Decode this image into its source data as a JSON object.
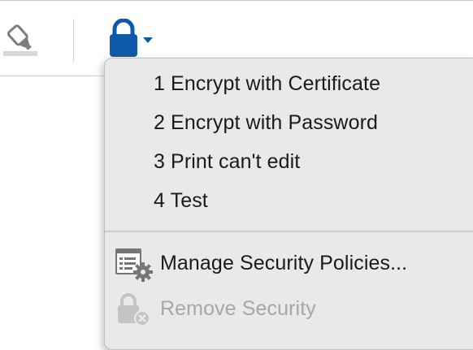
{
  "toolbar": {
    "highlighter_icon": "highlighter-pen-icon",
    "security_icon": "lock-icon",
    "security_caret_icon": "chevron-down-icon",
    "accent_color": "#0f5aa8"
  },
  "security_menu": {
    "policies": [
      {
        "label": "1 Encrypt with Certificate"
      },
      {
        "label": "2 Encrypt with Password"
      },
      {
        "label": "3 Print can't edit"
      },
      {
        "label": "4 Test"
      }
    ],
    "manage": {
      "label": "Manage Security Policies...",
      "icon": "policy-settings-icon"
    },
    "remove": {
      "label": "Remove Security",
      "icon": "lock-remove-icon",
      "disabled": true
    }
  }
}
